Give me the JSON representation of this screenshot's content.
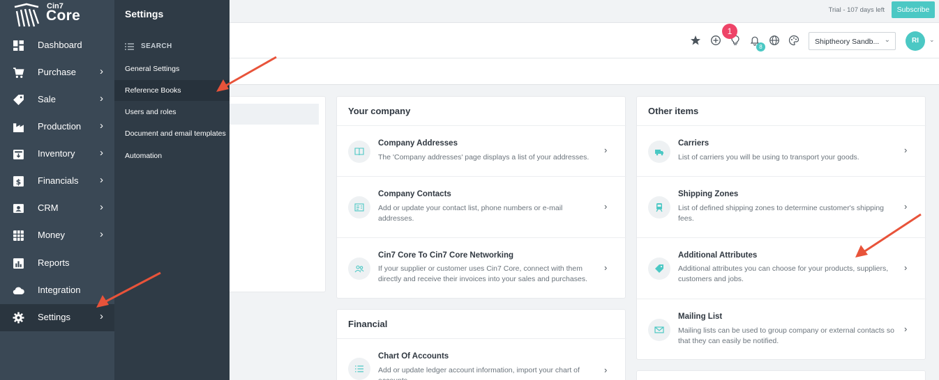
{
  "logo": {
    "small": "Cin7",
    "big": "Core"
  },
  "nav": {
    "items": [
      {
        "label": "Dashboard",
        "icon": "dashboard-icon",
        "chevron": false
      },
      {
        "label": "Purchase",
        "icon": "cart-icon",
        "chevron": true
      },
      {
        "label": "Sale",
        "icon": "tag-icon",
        "chevron": true
      },
      {
        "label": "Production",
        "icon": "factory-icon",
        "chevron": true
      },
      {
        "label": "Inventory",
        "icon": "inventory-icon",
        "chevron": true
      },
      {
        "label": "Financials",
        "icon": "dollar-icon",
        "chevron": true
      },
      {
        "label": "CRM",
        "icon": "contact-card-icon",
        "chevron": true
      },
      {
        "label": "Money",
        "icon": "calculator-icon",
        "chevron": true
      },
      {
        "label": "Reports",
        "icon": "report-chart-icon",
        "chevron": false
      },
      {
        "label": "Integration",
        "icon": "cloud-icon",
        "chevron": false
      },
      {
        "label": "Settings",
        "icon": "gear-icon",
        "chevron": true
      }
    ],
    "chevron_glyph": "›"
  },
  "flyout": {
    "title": "Settings",
    "search_label": "SEARCH",
    "items": [
      "General Settings",
      "Reference Books",
      "Users and roles",
      "Document and email templates",
      "Automation"
    ]
  },
  "trial": {
    "text": "Trial - 107 days left",
    "subscribe_label": "Subscribe"
  },
  "toolbar": {
    "notification_count": "1",
    "bell_count": "8",
    "company_select": "Shiptheory Sandb...",
    "avatar_initials": "RI",
    "chevron_down": "⌄"
  },
  "cards": {
    "your_company": {
      "title": "Your company",
      "rows": [
        {
          "title": "Company Addresses",
          "desc": "The 'Company addresses' page displays a list of your addresses.",
          "icon": "book-icon"
        },
        {
          "title": "Company Contacts",
          "desc": "Add or update your contact list, phone numbers or e-mail addresses.",
          "icon": "contact-list-icon"
        },
        {
          "title": "Cin7 Core To Cin7 Core Networking",
          "desc": "If your supplier or customer uses Cin7 Core, connect with them directly and receive their invoices into your sales and purchases.",
          "icon": "users-icon"
        }
      ]
    },
    "financial": {
      "title": "Financial",
      "rows": [
        {
          "title": "Chart Of Accounts",
          "desc": "Add or update ledger account information, import your chart of accounts",
          "icon": "list-icon"
        }
      ]
    },
    "other_items": {
      "title": "Other items",
      "rows": [
        {
          "title": "Carriers",
          "desc": "List of carriers you will be using to transport your goods.",
          "icon": "truck-icon"
        },
        {
          "title": "Shipping Zones",
          "desc": "List of defined shipping zones to determine customer's shipping fees.",
          "icon": "train-icon"
        },
        {
          "title": "Additional Attributes",
          "desc": "Additional attributes you can choose for your products, suppliers, customers and jobs.",
          "icon": "tag-icon"
        },
        {
          "title": "Mailing List",
          "desc": "Mailing lists can be used to group company or external contacts so that they can easily be notified.",
          "icon": "mail-icon"
        }
      ]
    }
  },
  "colors": {
    "nav_bg": "#3a4855",
    "flyout_bg": "#2f3b46",
    "accent": "#4bc8c4",
    "badge_red": "#ee4468",
    "arrow": "#e8533a"
  }
}
